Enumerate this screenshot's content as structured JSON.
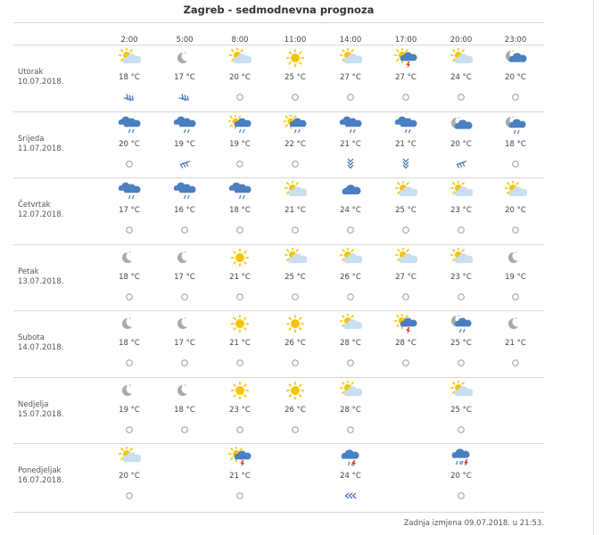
{
  "title": "Zagreb - sedmodnevna prognoza",
  "hours": [
    "2:00",
    "5:00",
    "8:00",
    "11:00",
    "14:00",
    "17:00",
    "20:00",
    "23:00"
  ],
  "days": [
    {
      "name": "Utorak",
      "date": "10.07.2018.",
      "cells": [
        {
          "icon": "partly-cloudy-day-icon",
          "temp": "18 °C",
          "wind": "wind-arrows-southwest-icon"
        },
        {
          "icon": "clear-night-icon",
          "temp": "17 °C",
          "wind": "wind-arrows-southwest-icon"
        },
        {
          "icon": "partly-cloudy-day-icon",
          "temp": "20 °C",
          "wind": "calm-circle-icon"
        },
        {
          "icon": "sunny-icon",
          "temp": "25 °C",
          "wind": "calm-circle-icon"
        },
        {
          "icon": "partly-cloudy-day-icon",
          "temp": "27 °C",
          "wind": "calm-circle-icon"
        },
        {
          "icon": "thunderstorm-sun-icon",
          "temp": "27 °C",
          "wind": "calm-circle-icon"
        },
        {
          "icon": "partly-cloudy-day-icon",
          "temp": "24 °C",
          "wind": "calm-circle-icon"
        },
        {
          "icon": "cloudy-night-icon",
          "temp": "20 °C",
          "wind": "calm-circle-icon"
        }
      ]
    },
    {
      "name": "Srijeda",
      "date": "11.07.2018.",
      "cells": [
        {
          "icon": "rain-cloud-icon",
          "temp": "20 °C",
          "wind": "calm-circle-icon"
        },
        {
          "icon": "rain-cloud-icon",
          "temp": "19 °C",
          "wind": "wind-arrows-northeast-icon"
        },
        {
          "icon": "rain-sun-icon",
          "temp": "19 °C",
          "wind": "calm-circle-icon"
        },
        {
          "icon": "rain-sun-icon",
          "temp": "22 °C",
          "wind": "calm-circle-icon"
        },
        {
          "icon": "rain-cloud-icon",
          "temp": "21 °C",
          "wind": "wind-arrows-south-icon"
        },
        {
          "icon": "rain-cloud-icon",
          "temp": "21 °C",
          "wind": "wind-arrows-south-icon"
        },
        {
          "icon": "cloudy-night-icon",
          "temp": "20 °C",
          "wind": "wind-arrows-northeast-icon"
        },
        {
          "icon": "rain-night-icon",
          "temp": "18 °C",
          "wind": "calm-circle-icon"
        }
      ]
    },
    {
      "name": "Četvrtak",
      "date": "12.07.2018.",
      "cells": [
        {
          "icon": "rain-cloud-icon",
          "temp": "17 °C",
          "wind": "calm-circle-icon"
        },
        {
          "icon": "rain-cloud-icon",
          "temp": "16 °C",
          "wind": "calm-circle-icon"
        },
        {
          "icon": "rain-cloud-icon",
          "temp": "18 °C",
          "wind": "calm-circle-icon"
        },
        {
          "icon": "partly-cloudy-day-icon",
          "temp": "21 °C",
          "wind": "calm-circle-icon"
        },
        {
          "icon": "cloud-icon",
          "temp": "24 °C",
          "wind": "calm-circle-icon"
        },
        {
          "icon": "partly-cloudy-day-icon",
          "temp": "25 °C",
          "wind": "calm-circle-icon"
        },
        {
          "icon": "partly-cloudy-day-icon",
          "temp": "23 °C",
          "wind": "calm-circle-icon"
        },
        {
          "icon": "partly-cloudy-day-icon",
          "temp": "20 °C",
          "wind": "calm-circle-icon"
        }
      ]
    },
    {
      "name": "Petak",
      "date": "13.07.2018.",
      "cells": [
        {
          "icon": "clear-night-icon",
          "temp": "18 °C",
          "wind": "calm-circle-icon"
        },
        {
          "icon": "clear-night-icon",
          "temp": "17 °C",
          "wind": "calm-circle-icon"
        },
        {
          "icon": "sunny-icon",
          "temp": "21 °C",
          "wind": "calm-circle-icon"
        },
        {
          "icon": "partly-cloudy-day-icon",
          "temp": "25 °C",
          "wind": "calm-circle-icon"
        },
        {
          "icon": "partly-cloudy-day-icon",
          "temp": "26 °C",
          "wind": "calm-circle-icon"
        },
        {
          "icon": "partly-cloudy-day-icon",
          "temp": "27 °C",
          "wind": "calm-circle-icon"
        },
        {
          "icon": "partly-cloudy-day-icon",
          "temp": "23 °C",
          "wind": "calm-circle-icon"
        },
        {
          "icon": "clear-night-icon",
          "temp": "19 °C",
          "wind": "calm-circle-icon"
        }
      ]
    },
    {
      "name": "Subota",
      "date": "14.07.2018.",
      "cells": [
        {
          "icon": "clear-night-icon",
          "temp": "18 °C",
          "wind": "calm-circle-icon"
        },
        {
          "icon": "clear-night-icon",
          "temp": "17 °C",
          "wind": "calm-circle-icon"
        },
        {
          "icon": "sunny-icon",
          "temp": "21 °C",
          "wind": "calm-circle-icon"
        },
        {
          "icon": "sunny-icon",
          "temp": "26 °C",
          "wind": "calm-circle-icon"
        },
        {
          "icon": "partly-cloudy-day-icon",
          "temp": "28 °C",
          "wind": "calm-circle-icon"
        },
        {
          "icon": "thunderstorm-sun-icon",
          "temp": "28 °C",
          "wind": "calm-circle-icon"
        },
        {
          "icon": "rain-night-icon",
          "temp": "25 °C",
          "wind": "calm-circle-icon"
        },
        {
          "icon": "clear-night-icon",
          "temp": "21 °C",
          "wind": "calm-circle-icon"
        }
      ]
    },
    {
      "name": "Nedjelja",
      "date": "15.07.2018.",
      "cells": [
        {
          "icon": "clear-night-icon",
          "temp": "19 °C",
          "wind": "calm-circle-icon"
        },
        {
          "icon": "clear-night-icon",
          "temp": "18 °C",
          "wind": "calm-circle-icon"
        },
        {
          "icon": "sunny-icon",
          "temp": "23 °C",
          "wind": "calm-circle-icon"
        },
        {
          "icon": "sunny-icon",
          "temp": "26 °C",
          "wind": "calm-circle-icon"
        },
        {
          "icon": "partly-cloudy-day-icon",
          "temp": "28 °C",
          "wind": "calm-circle-icon"
        },
        null,
        {
          "icon": "partly-cloudy-day-icon",
          "temp": "25 °C",
          "wind": "calm-circle-icon"
        },
        null
      ]
    },
    {
      "name": "Ponedjeljak",
      "date": "16.07.2018.",
      "cells": [
        {
          "icon": "partly-cloudy-day-icon",
          "temp": "20 °C",
          "wind": "calm-circle-icon"
        },
        null,
        {
          "icon": "thunderstorm-sun-icon",
          "temp": "21 °C",
          "wind": "calm-circle-icon"
        },
        null,
        {
          "icon": "thunderstorm-cloud-icon",
          "temp": "24 °C",
          "wind": "wind-arrows-east-icon"
        },
        null,
        {
          "icon": "thunderstorm-rain-icon",
          "temp": "20 °C",
          "wind": "calm-circle-icon"
        },
        null
      ]
    }
  ],
  "footer": "Zadnja izmjena 09.07.2018. u 21:53.",
  "colors": {
    "sun": "#f5c400",
    "cloud_light": "#c9def0",
    "cloud_dark": "#4a7fc1",
    "moon": "#a9a9a9",
    "lightning": "#e03020",
    "wind": "#3a6fb8",
    "rule": "#d8d8d8"
  }
}
